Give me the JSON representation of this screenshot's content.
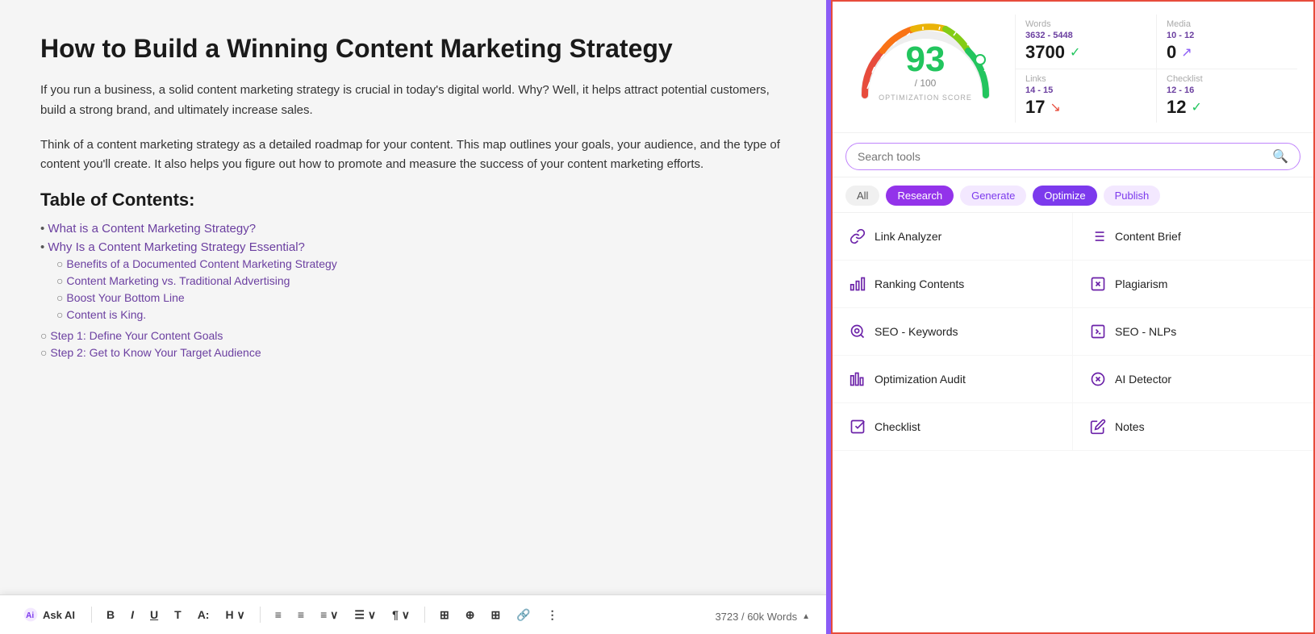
{
  "editor": {
    "title": "How to Build a Winning Content Marketing Strategy",
    "para1": "If you run a business, a solid content marketing strategy is crucial in today's digital world. Why? Well, it helps attract potential customers, build a strong brand, and ultimately increase sales.",
    "para2": "Think of a content marketing strategy as a detailed roadmap for your content. This map outlines your goals, your audience, and the type of content you'll create. It also helps you figure out how to promote and measure the success of your content marketing efforts.",
    "toc_heading": "Table of Contents:",
    "toc_items": [
      {
        "label": "What is a Content Marketing Strategy?",
        "sub": []
      },
      {
        "label": "Why Is a Content Marketing Strategy Essential?",
        "sub": [
          "Benefits of a Documented Content Marketing Strategy",
          "Content Marketing vs. Traditional Advertising",
          "Boost Your Bottom Line",
          "Content is King."
        ]
      }
    ],
    "toc_steps": [
      "Step 1: Define Your Content Goals",
      "Step 2: Get to Know Your Target Audience"
    ],
    "word_count": "3723 / 60k Words"
  },
  "toolbar": {
    "ask_ai_label": "Ask AI",
    "buttons": [
      "B",
      "I",
      "U",
      "T",
      "A:",
      "H",
      "≡",
      "≡",
      "≡",
      "☰",
      "≡",
      "¶",
      "⊞",
      "⊕",
      "¶⇌",
      "🔗",
      "⋮"
    ]
  },
  "score": {
    "value": "93",
    "max": "/ 100",
    "label": "OPTIMIZATION SCORE",
    "words": {
      "label": "Words",
      "range": "3632 - 5448",
      "value": "3700",
      "status": "check"
    },
    "media": {
      "label": "Media",
      "range": "10 - 12",
      "value": "0",
      "status": "arrow-up"
    },
    "links": {
      "label": "Links",
      "range": "14 - 15",
      "value": "17",
      "status": "arrow-down"
    },
    "checklist": {
      "label": "Checklist",
      "range": "12 - 16",
      "value": "12",
      "status": "check"
    }
  },
  "search": {
    "placeholder": "Search tools"
  },
  "filter_tabs": [
    {
      "id": "all",
      "label": "All",
      "class": "all"
    },
    {
      "id": "research",
      "label": "Research",
      "class": "research"
    },
    {
      "id": "generate",
      "label": "Generate",
      "class": "generate"
    },
    {
      "id": "optimize",
      "label": "Optimize",
      "class": "optimize"
    },
    {
      "id": "publish",
      "label": "Publish",
      "class": "publish"
    }
  ],
  "tools": [
    {
      "left": {
        "id": "link-analyzer",
        "label": "Link Analyzer",
        "icon": "link"
      },
      "right": {
        "id": "content-brief",
        "label": "Content Brief",
        "icon": "list"
      }
    },
    {
      "left": {
        "id": "ranking-contents",
        "label": "Ranking Contents",
        "icon": "bar-chart"
      },
      "right": {
        "id": "plagiarism",
        "label": "Plagiarism",
        "icon": "shield"
      }
    },
    {
      "left": {
        "id": "seo-keywords",
        "label": "SEO - Keywords",
        "icon": "search-circle"
      },
      "right": {
        "id": "seo-nlps",
        "label": "SEO - NLPs",
        "icon": "brackets"
      }
    },
    {
      "left": {
        "id": "optimization-audit",
        "label": "Optimization Audit",
        "icon": "audit"
      },
      "right": {
        "id": "ai-detector",
        "label": "AI Detector",
        "icon": "ai-detect"
      }
    },
    {
      "left": {
        "id": "checklist",
        "label": "Checklist",
        "icon": "checklist"
      },
      "right": {
        "id": "notes",
        "label": "Notes",
        "icon": "notes"
      }
    }
  ]
}
